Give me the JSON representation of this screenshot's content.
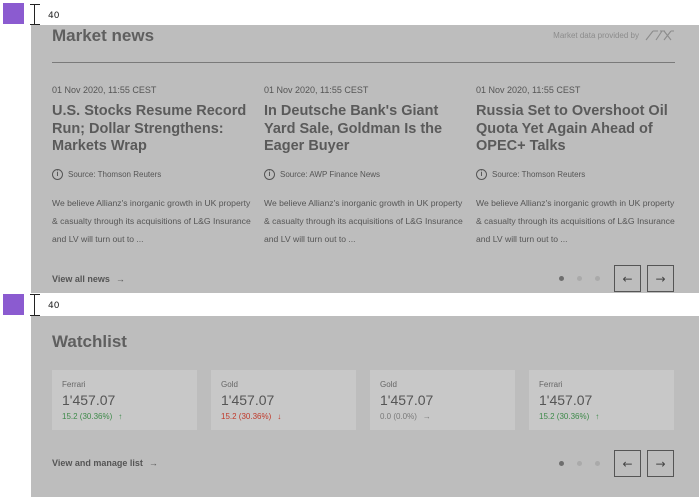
{
  "spacers": [
    {
      "label": "40"
    },
    {
      "label": "40"
    }
  ],
  "news": {
    "title": "Market news",
    "provider_text": "Market data provided by",
    "provider_logo": "SIX",
    "articles": [
      {
        "date": "01 Nov 2020, 11:55 CEST",
        "title": "U.S. Stocks Resume Record Run; Dollar Strengthens: Markets Wrap",
        "source": "Source: Thomson Reuters",
        "excerpt": "We believe Allianz's inorganic growth in UK property & casualty through its acquisitions of L&G Insurance and LV will turn out to ..."
      },
      {
        "date": "01 Nov 2020, 11:55 CEST",
        "title": "In Deutsche Bank's Giant Yard Sale, Goldman Is the Eager Buyer",
        "source": "Source: AWP Finance News",
        "excerpt": "We believe Allianz's inorganic growth in UK property & casualty through its acquisitions of L&G Insurance and LV will turn out to ..."
      },
      {
        "date": "01 Nov 2020, 11:55 CEST",
        "title": "Russia Set to Overshoot Oil Quota Yet Again Ahead of OPEC+ Talks",
        "source": "Source: Thomson Reuters",
        "excerpt": "We believe Allianz's inorganic growth in UK property & casualty through its acquisitions of L&G Insurance and LV will turn out to ..."
      }
    ],
    "view_all_label": "View all news",
    "pagination": {
      "total": 3,
      "active": 0
    }
  },
  "watchlist": {
    "title": "Watchlist",
    "items": [
      {
        "name": "Ferrari",
        "price": "1'457.07",
        "change": "15.2 (30.36%)",
        "direction": "up",
        "color": "#3e8a4a"
      },
      {
        "name": "Gold",
        "price": "1'457.07",
        "change": "15.2 (30.36%)",
        "direction": "down",
        "color": "#c0392b"
      },
      {
        "name": "Gold",
        "price": "1'457.07",
        "change": "0.0 (0.0%)",
        "direction": "flat",
        "color": "#7a7a7a"
      },
      {
        "name": "Ferrari",
        "price": "1'457.07",
        "change": "15.2 (30.36%)",
        "direction": "up",
        "color": "#3e8a4a"
      }
    ],
    "manage_label": "View and manage list",
    "pagination": {
      "total": 3,
      "active": 0
    }
  },
  "icons": {
    "arrow_right": "→",
    "arrow_up": "↑",
    "arrow_down": "↓",
    "prev": "←",
    "next": "→",
    "info": "i"
  }
}
